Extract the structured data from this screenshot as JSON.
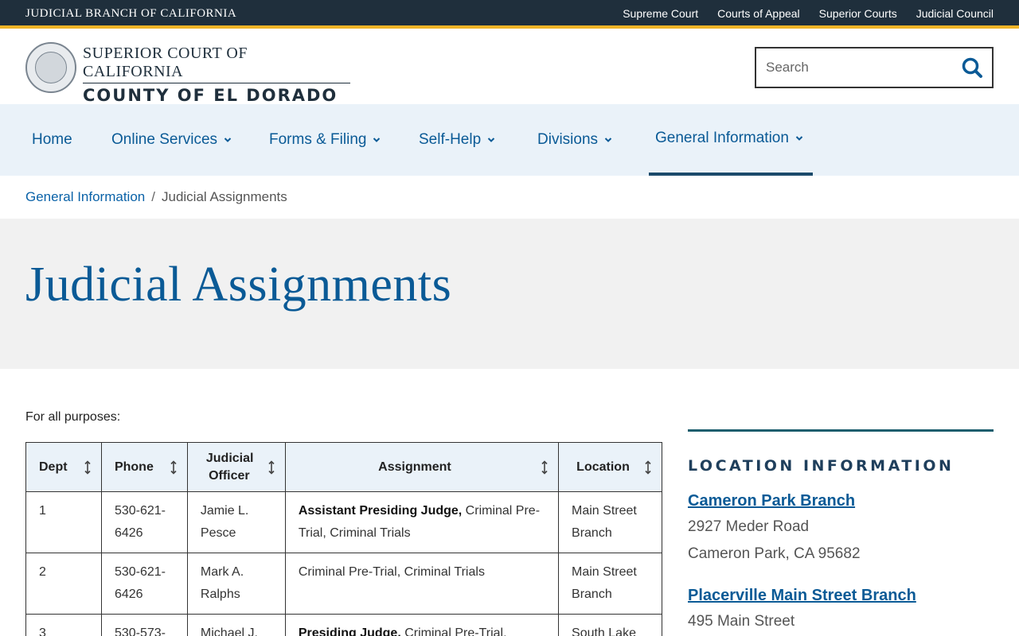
{
  "topbar": {
    "brand": "JUDICIAL BRANCH OF CALIFORNIA",
    "links": [
      "Supreme Court",
      "Courts of Appeal",
      "Superior Courts",
      "Judicial Council"
    ]
  },
  "header": {
    "line1": "SUPERIOR COURT OF CALIFORNIA",
    "line2": "COUNTY OF EL DORADO",
    "search_placeholder": "Search",
    "search_icon": "search-icon"
  },
  "nav": {
    "items": [
      {
        "label": "Home",
        "dropdown": false
      },
      {
        "label": "Online Services",
        "dropdown": true
      },
      {
        "label": "Forms & Filing",
        "dropdown": true
      },
      {
        "label": "Self-Help",
        "dropdown": true
      },
      {
        "label": "Divisions",
        "dropdown": true
      },
      {
        "label": "General Information",
        "dropdown": true,
        "active": true
      }
    ]
  },
  "breadcrumb": {
    "parent": "General Information",
    "separator": "/",
    "current": "Judicial Assignments"
  },
  "page_title": "Judicial Assignments",
  "intro": "For all purposes:",
  "table": {
    "headers": [
      "Dept",
      "Phone",
      "Judicial Officer",
      "Assignment",
      "Location"
    ],
    "rows": [
      {
        "dept": "1",
        "phone": "530-621-6426",
        "officer": "Jamie L. Pesce",
        "assignment_bold": "Assistant Presiding Judge,",
        "assignment_rest": " Criminal Pre-Trial, Criminal Trials",
        "location": "Main Street Branch"
      },
      {
        "dept": "2",
        "phone": "530-621-6426",
        "officer": "Mark A. Ralphs",
        "assignment_bold": "",
        "assignment_rest": "Criminal Pre-Trial, Criminal Trials",
        "location": "Main Street Branch"
      },
      {
        "dept": "3",
        "phone": "530-573-",
        "officer": "Michael J.",
        "assignment_bold": "Presiding Judge,",
        "assignment_rest": " Criminal Pre-Trial,",
        "location": "South Lake"
      }
    ]
  },
  "sidebar": {
    "heading": "LOCATION INFORMATION",
    "branches": [
      {
        "name": "Cameron Park Branch",
        "address1": "2927 Meder Road",
        "address2": "Cameron Park, CA 95682"
      },
      {
        "name": "Placerville Main Street Branch",
        "address1": "495 Main Street",
        "address2": ""
      }
    ]
  },
  "colors": {
    "topbar": "#1f2f3c",
    "accent_gold": "#f0b427",
    "link_blue": "#0a5a96",
    "nav_bg": "#eaf2f9",
    "hero_bg": "#f1f1f1"
  }
}
